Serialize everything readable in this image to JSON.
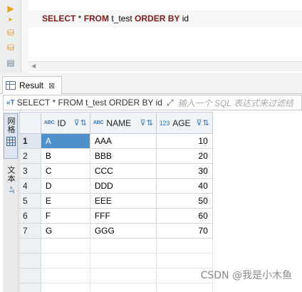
{
  "editor": {
    "sql_tokens": [
      {
        "text": "SELECT",
        "kw": true
      },
      {
        "text": " * ",
        "kw": false
      },
      {
        "text": "FROM",
        "kw": true
      },
      {
        "text": " t_test ",
        "kw": false
      },
      {
        "text": "ORDER BY",
        "kw": true
      },
      {
        "text": " id",
        "kw": false
      }
    ],
    "toolbar_icons": [
      "execute-icon",
      "execute-script-icon",
      "explain-plan-icon",
      "load-plan-icon",
      "export-icon"
    ]
  },
  "result_tab": {
    "label": "Result",
    "close_glyph": "⊠"
  },
  "filter_bar": {
    "icon": "sql-filter-icon",
    "icon_text": "«T",
    "query": "SELECT * FROM t_test ORDER BY id",
    "placeholder": "输入一个 SQL 表达式来过滤结"
  },
  "side_tabs": {
    "grid_label": "网格",
    "text_label": "文本"
  },
  "grid": {
    "columns": [
      {
        "name": "ID",
        "type_badge": "ABC",
        "numeric": false
      },
      {
        "name": "NAME",
        "type_badge": "ABC",
        "numeric": false
      },
      {
        "name": "AGE",
        "type_badge": "123",
        "numeric": true
      }
    ],
    "rows": [
      {
        "num": "1",
        "cells": [
          "A",
          "AAA",
          "10"
        ]
      },
      {
        "num": "2",
        "cells": [
          "B",
          "BBB",
          "20"
        ]
      },
      {
        "num": "3",
        "cells": [
          "C",
          "CCC",
          "30"
        ]
      },
      {
        "num": "4",
        "cells": [
          "D",
          "DDD",
          "40"
        ]
      },
      {
        "num": "5",
        "cells": [
          "E",
          "EEE",
          "50"
        ]
      },
      {
        "num": "6",
        "cells": [
          "F",
          "FFF",
          "60"
        ]
      },
      {
        "num": "7",
        "cells": [
          "G",
          "GGG",
          "70"
        ]
      }
    ],
    "empty_rows": 4,
    "selected_row": 0
  },
  "watermark": "CSDN @我是小木鱼",
  "colors": {
    "keyword": "#7d1a1a",
    "selection": "#4f8fcc",
    "accent": "#3b77b0"
  }
}
